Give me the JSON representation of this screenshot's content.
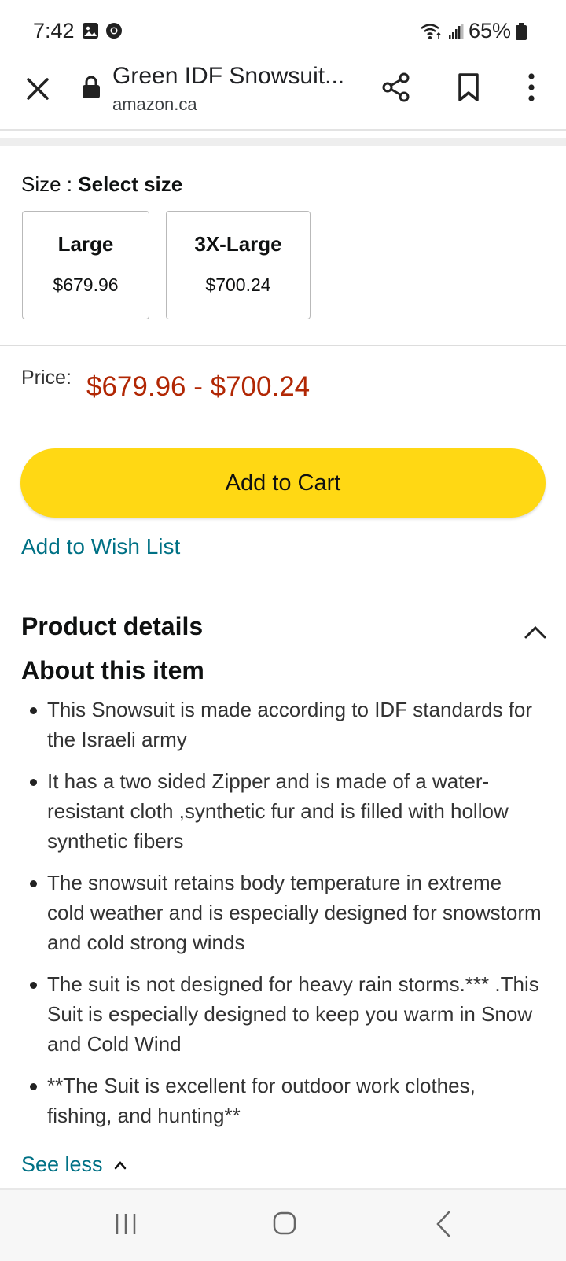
{
  "status_bar": {
    "time": "7:42",
    "battery": "65%"
  },
  "toolbar": {
    "title": "Green IDF Snowsuit...",
    "url": "amazon.ca"
  },
  "size": {
    "label": "Size :",
    "selected": "Select size",
    "options": [
      {
        "name": "Large",
        "price": "$679.96"
      },
      {
        "name": "3X-Large",
        "price": "$700.24"
      }
    ]
  },
  "price": {
    "label": "Price:",
    "range": "$679.96 - $700.24"
  },
  "buttons": {
    "add_to_cart": "Add to Cart",
    "add_to_wish_list": "Add to Wish List"
  },
  "product_details": {
    "title": "Product details",
    "about_title": "About this item",
    "bullets": [
      "This Snowsuit is made according to IDF standards for the Israeli army",
      "It has a two sided Zipper and is made of a water-resistant cloth ,synthetic fur and is filled with hollow synthetic fibers",
      "The snowsuit retains body temperature in extreme cold weather and is especially designed for snowstorm and cold strong winds",
      "The suit is not designed for heavy rain storms.*** .This Suit is especially designed to keep you warm in Snow and Cold Wind",
      "**The Suit is excellent for outdoor work clothes, fishing, and hunting**"
    ],
    "see_less": "See less"
  },
  "colors": {
    "accent_link": "#007185",
    "price": "#b12704",
    "cart_button": "#ffd814"
  }
}
